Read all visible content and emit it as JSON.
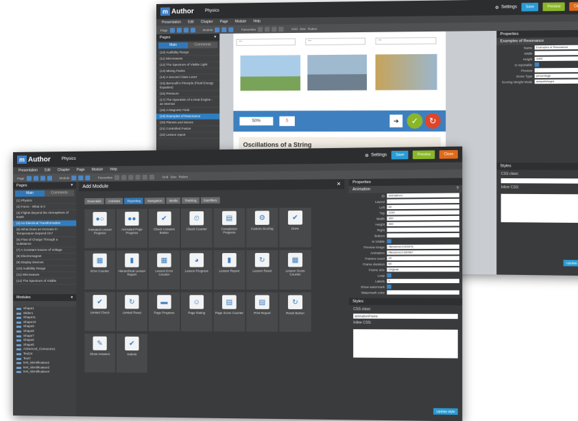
{
  "app": {
    "name": "Author",
    "logo_letter": "m",
    "project": "Physics"
  },
  "toolbar": {
    "settings": "Settings",
    "save": "Save",
    "preview": "Preview",
    "close": "Close"
  },
  "menu": [
    "Presentation",
    "Edit",
    "Chapter",
    "Page",
    "Module",
    "Help"
  ],
  "toolbar_labels": {
    "page": "Page",
    "module": "Module",
    "favourites": "Favourites",
    "grid": "Grid",
    "size": "Size",
    "rulers": "Rulers"
  },
  "pages_panel": {
    "title": "Pages",
    "tab_main": "Main",
    "tab_comments": "Comments"
  },
  "back": {
    "pages": [
      "(10) Audibility Range",
      "(11) Microwaves",
      "(12) The Spectrum of Visible Light",
      "(13) Mixing Paints",
      "(14) A Second Class Lever",
      "(15) Bernoulli's Principle (Fluid Energy Equation)",
      "(16) Pressure",
      "(17) The Operation of a Heat Engine - an Internal",
      "(18) A Magnetic Field",
      "(19) Examples of Resonance",
      "(20) Planets and Moons",
      "(21) Controlled Fusion",
      "(22) Lesson report"
    ],
    "selected_index": 9,
    "canvas": {
      "score": "50%",
      "count": "5",
      "heading": "Oscillations of a String",
      "placeholder": "***"
    },
    "props": {
      "title": "Properties",
      "section": "Examples of Resonance",
      "rows": [
        {
          "k": "Name",
          "v": "Examples of Resonance"
        },
        {
          "k": "Width",
          "v": ""
        },
        {
          "k": "Height",
          "v": "1000"
        },
        {
          "k": "Is reportable",
          "v": ""
        },
        {
          "k": "Preview",
          "v": "..."
        },
        {
          "k": "Score Type",
          "v": "percentage"
        },
        {
          "k": "Scoring Weight Mode",
          "v": "defaultWeight"
        }
      ]
    },
    "styles": {
      "title": "Styles",
      "css_class": "CSS class:",
      "inline_css": "Inline CSS:",
      "update": "Update style"
    }
  },
  "front": {
    "pages": [
      "(1) Physics",
      "(2) Force - What is It",
      "(3) Flights Beyond the Atmosphere of Earth",
      "(4) An Electrical Transformation",
      "(5) What Does an Increase in Temperature Depend On?",
      "(6) Flow of Charge Through a Substance",
      "(7) A Constant Source of Voltage",
      "(8) Electromagnet",
      "(9) Display Devices",
      "(10) Audibility Range",
      "(11) Microwaves",
      "(12) The Spectrum of Visible"
    ],
    "selected_index": 3,
    "modules_title": "Modules",
    "modules": [
      "Shape1",
      "Slider1",
      "Shape11",
      "Shape10",
      "Shape9",
      "Shape8",
      "Shape7",
      "Shape6",
      "Shape5",
      "Advanced_Connector1",
      "Text24",
      "Text7",
      "text_identification2",
      "text_identification3",
      "text_identification4"
    ],
    "add_module": {
      "title": "Add Module",
      "categories": [
        "Essentials",
        "Activities",
        "Reporting",
        "Navigation",
        "Media",
        "Tracking",
        "Gamifiers"
      ],
      "active_category": 2,
      "items": [
        {
          "label": "Animated Lesson Progress",
          "icon": "lesson-progress-icon",
          "glyph": "●○"
        },
        {
          "label": "Animated Page Progress",
          "icon": "page-progress-icon",
          "glyph": "●●"
        },
        {
          "label": "Check Answers Button",
          "icon": "check-answers-icon",
          "glyph": "✔"
        },
        {
          "label": "Check Counter",
          "icon": "check-counter-icon",
          "glyph": "⏲"
        },
        {
          "label": "Completion Progress",
          "icon": "completion-icon",
          "glyph": "▤"
        },
        {
          "label": "Custom Scoring",
          "icon": "custom-scoring-icon",
          "glyph": "⚙"
        },
        {
          "label": "Done",
          "icon": "done-icon",
          "glyph": "✔"
        },
        {
          "label": "Error Counter",
          "icon": "error-counter-icon",
          "glyph": "▦"
        },
        {
          "label": "Hierarchical Lesson Report",
          "icon": "hier-report-icon",
          "glyph": "▮"
        },
        {
          "label": "Lesson Error Counter",
          "icon": "lesson-error-icon",
          "glyph": "▦"
        },
        {
          "label": "Lesson Progress",
          "icon": "lesson-pie-icon",
          "glyph": "◕"
        },
        {
          "label": "Lesson Report",
          "icon": "lesson-report-icon",
          "glyph": "▮"
        },
        {
          "label": "Lesson Reset",
          "icon": "lesson-reset-icon",
          "glyph": "↻"
        },
        {
          "label": "Lesson Score Counter",
          "icon": "score-counter-icon",
          "glyph": "▦"
        },
        {
          "label": "Limited Check",
          "icon": "limited-check-icon",
          "glyph": "✔"
        },
        {
          "label": "Limited Reset",
          "icon": "limited-reset-icon",
          "glyph": "↻"
        },
        {
          "label": "Page Progress",
          "icon": "page-progress-bar-icon",
          "glyph": "▬"
        },
        {
          "label": "Page Rating",
          "icon": "page-rating-icon",
          "glyph": "☺"
        },
        {
          "label": "Page Score Counter",
          "icon": "page-score-icon",
          "glyph": "▤"
        },
        {
          "label": "Print Report",
          "icon": "print-report-icon",
          "glyph": "▤"
        },
        {
          "label": "Reset Button",
          "icon": "reset-button-icon",
          "glyph": "↻"
        },
        {
          "label": "Show Answers",
          "icon": "show-answers-icon",
          "glyph": "✎"
        },
        {
          "label": "Submit",
          "icon": "submit-icon",
          "glyph": "✔"
        }
      ]
    },
    "props": {
      "title": "Properties",
      "section": "Animation",
      "rows": [
        {
          "k": "ID",
          "v": "animation1"
        },
        {
          "k": "Layout",
          "v": "..."
        },
        {
          "k": "Left",
          "v": "50"
        },
        {
          "k": "Top",
          "v": "1169"
        },
        {
          "k": "Width",
          "v": "300"
        },
        {
          "k": "Height",
          "v": "300"
        },
        {
          "k": "Right",
          "v": ""
        },
        {
          "k": "Bottom",
          "v": ""
        },
        {
          "k": "Is Visible",
          "v": ""
        },
        {
          "k": "Preview image",
          "v": "/file/serve/1253576"
        },
        {
          "k": "Animation",
          "v": "/file/serve/1330587"
        },
        {
          "k": "Frames count",
          "v": "20"
        },
        {
          "k": "Frame duration",
          "v": "60"
        },
        {
          "k": "Frame size",
          "v": "Original"
        },
        {
          "k": "Loop",
          "v": ""
        },
        {
          "k": "Labels",
          "v": "1"
        },
        {
          "k": "Show watermark",
          "v": ""
        },
        {
          "k": "Watermark color",
          "v": ""
        }
      ]
    },
    "styles": {
      "title": "Styles",
      "css_class": "CSS class:",
      "css_value": "animationFrame",
      "inline_css": "Inline CSS:",
      "update": "Update style"
    }
  }
}
